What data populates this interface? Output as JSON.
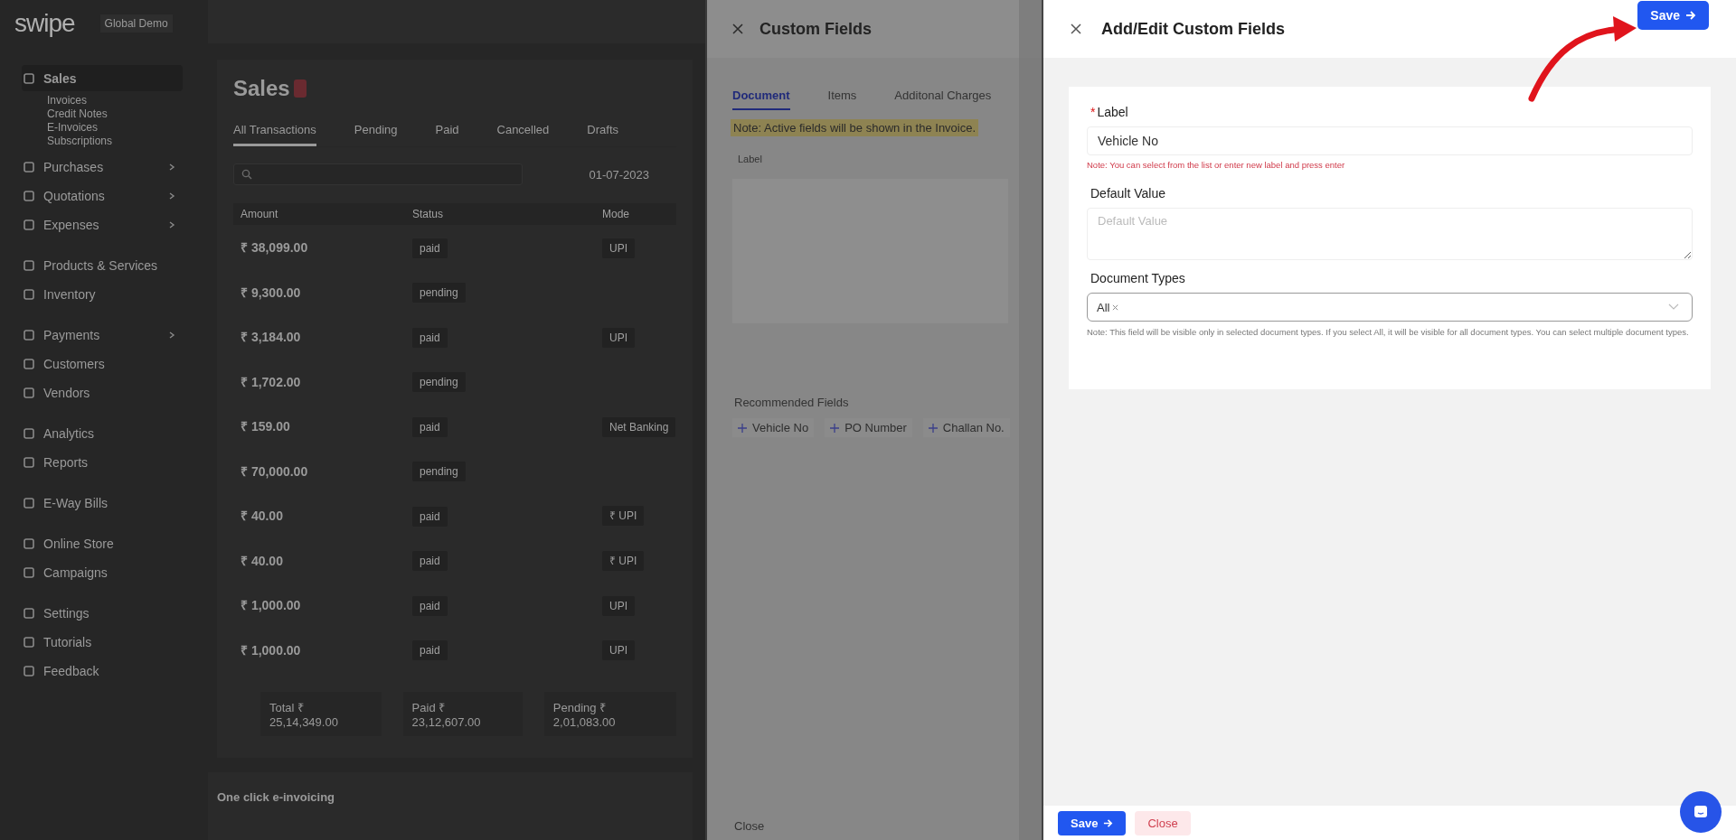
{
  "sidebar": {
    "logo": "swipe",
    "org": "Global Demo",
    "groups": [
      [
        {
          "label": "Sales",
          "selected": true,
          "expandable": false,
          "children": [
            {
              "label": "Invoices"
            },
            {
              "label": "Credit Notes"
            },
            {
              "label": "E-Invoices"
            },
            {
              "label": "Subscriptions"
            }
          ]
        },
        {
          "label": "Purchases",
          "selected": false,
          "expandable": true
        },
        {
          "label": "Quotations",
          "selected": false,
          "expandable": true
        },
        {
          "label": "Expenses",
          "selected": false,
          "expandable": true
        }
      ],
      [
        {
          "label": "Products & Services",
          "selected": false,
          "expandable": false
        },
        {
          "label": "Inventory",
          "selected": false,
          "expandable": false
        }
      ],
      [
        {
          "label": "Payments",
          "selected": false,
          "expandable": true
        },
        {
          "label": "Customers",
          "selected": false,
          "expandable": false
        },
        {
          "label": "Vendors",
          "selected": false,
          "expandable": false
        }
      ],
      [
        {
          "label": "Analytics",
          "selected": false,
          "expandable": false
        },
        {
          "label": "Reports",
          "selected": false,
          "expandable": false
        }
      ],
      [
        {
          "label": "E-Way Bills",
          "selected": false,
          "expandable": false
        }
      ],
      [
        {
          "label": "Online Store",
          "selected": false,
          "expandable": false
        },
        {
          "label": "Campaigns",
          "selected": false,
          "expandable": false
        }
      ],
      [
        {
          "label": "Settings",
          "selected": false,
          "expandable": false
        },
        {
          "label": "Tutorials",
          "selected": false,
          "expandable": false
        },
        {
          "label": "Feedback",
          "selected": false,
          "expandable": false
        }
      ]
    ]
  },
  "sales": {
    "title": "Sales",
    "tabs": [
      {
        "label": "All Transactions",
        "selected": true
      },
      {
        "label": "Pending",
        "selected": false
      },
      {
        "label": "Paid",
        "selected": false
      },
      {
        "label": "Cancelled",
        "selected": false
      },
      {
        "label": "Drafts",
        "selected": false
      }
    ],
    "date": "01-07-2023",
    "columns": [
      "Amount",
      "Status",
      "Mode"
    ],
    "rows": [
      {
        "amount": "₹ 38,099.00",
        "status": "paid",
        "mode": "UPI"
      },
      {
        "amount": "₹ 9,300.00",
        "status": "pending",
        "mode": ""
      },
      {
        "amount": "₹ 3,184.00",
        "status": "paid",
        "mode": "UPI"
      },
      {
        "amount": "₹ 1,702.00",
        "status": "pending",
        "mode": ""
      },
      {
        "amount": "₹ 159.00",
        "status": "paid",
        "mode": "Net Banking"
      },
      {
        "amount": "₹ 70,000.00",
        "status": "pending",
        "mode": ""
      },
      {
        "amount": "₹ 40.00",
        "status": "paid",
        "mode": "₹ UPI"
      },
      {
        "amount": "₹ 40.00",
        "status": "paid",
        "mode": "₹ UPI"
      },
      {
        "amount": "₹ 1,000.00",
        "status": "paid",
        "mode": "UPI"
      },
      {
        "amount": "₹ 1,000.00",
        "status": "paid",
        "mode": "UPI"
      }
    ],
    "totals": [
      "Total ₹ 25,14,349.00",
      "Paid ₹ 23,12,607.00",
      "Pending ₹ 2,01,083.00"
    ],
    "banner": "One click e-invoicing"
  },
  "custom_fields": {
    "title": "Custom Fields",
    "tabs": [
      {
        "label": "Document",
        "selected": true
      },
      {
        "label": "Items",
        "selected": false
      },
      {
        "label": "Additonal Charges",
        "selected": false
      }
    ],
    "note": "Note: Active fields will be shown in the Invoice.",
    "column": "Label",
    "recommended_title": "Recommended Fields",
    "recommended": [
      "Vehicle No",
      "PO Number",
      "Challan No."
    ],
    "close": "Close"
  },
  "editor": {
    "title": "Add/Edit Custom Fields",
    "save": "Save",
    "label": {
      "label": "Label",
      "required_mark": "*",
      "value": "Vehicle No",
      "hint": "Note: You can select from the list or enter new label and press enter"
    },
    "default_value": {
      "label": "Default Value",
      "placeholder": "Default Value"
    },
    "document_types": {
      "label": "Document Types",
      "tags": [
        "All"
      ],
      "note": "Note: This field will be visible only in selected document types. If you select All, it will be visible for all document types. You can select multiple document types."
    },
    "footer": [
      "Save",
      "Close"
    ]
  }
}
